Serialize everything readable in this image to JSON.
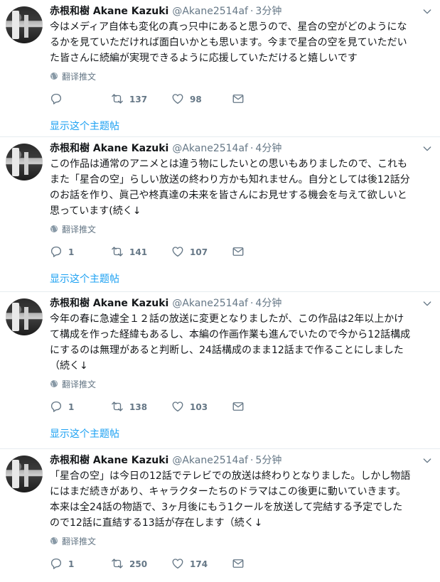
{
  "tweets": [
    {
      "name": "赤根和樹 Akane Kazuki",
      "handle": "@Akane2514af",
      "time": "3分钟",
      "lines": [
        "今はメディア自体も変化の真っ只中にあると思うので、星合の空がどのようにな",
        "るかを見ていただければ面白いかとも思います。今まで星合の空を見ていただい",
        "た皆さんに続編が実現できるように応援していただけると嬉しいです"
      ],
      "translate": "翻译推文",
      "reply_count": "",
      "retweet_count": "137",
      "like_count": "98",
      "thread_link": "显示这个主题帖"
    },
    {
      "name": "赤根和樹 Akane Kazuki",
      "handle": "@Akane2514af",
      "time": "4分钟",
      "lines": [
        "この作品は通常のアニメとは違う物にしたいとの思いもありましたので、これも",
        "また「星合の空」らしい放送の終わり方かも知れません。自分としては後12話分",
        "のお話を作り、眞己や柊真達の未来を皆さんにお見せする機会を与えて欲しいと",
        "思っています(続く↓"
      ],
      "translate": "翻译推文",
      "reply_count": "1",
      "retweet_count": "141",
      "like_count": "107",
      "thread_link": "显示这个主题帖"
    },
    {
      "name": "赤根和樹 Akane Kazuki",
      "handle": "@Akane2514af",
      "time": "4分钟",
      "lines": [
        "今年の春に急遽全１２話の放送に変更となりましたが、この作品は2年以上かけ",
        "て構成を作った経緯もあるし、本編の作画作業も進んでいたので今から12話構成",
        "にするのは無理があると判断し、24話構成のまま12話まで作ることにしました",
        "（続く↓"
      ],
      "translate": "翻译推文",
      "reply_count": "1",
      "retweet_count": "138",
      "like_count": "103",
      "thread_link": "显示这个主题帖"
    },
    {
      "name": "赤根和樹 Akane Kazuki",
      "handle": "@Akane2514af",
      "time": "5分钟",
      "lines": [
        "「星合の空」は今日の12話でテレビでの放送は終わりとなりました。しかし物語",
        "にはまだ続きがあり、キャラクターたちのドラマはこの後更に動いていきます。",
        "本来は全24話の物語で、3ヶ月後にもう1クールを放送して完結する予定でした",
        "ので12話に直結する13話が存在します（続く↓"
      ],
      "translate": "翻译推文",
      "reply_count": "1",
      "retweet_count": "250",
      "like_count": "174",
      "thread_link": ""
    }
  ],
  "dot": "·",
  "icons": {
    "avatar": "avatar",
    "caret": "chevron-down-icon",
    "translate": "globe-icon",
    "reply": "reply-icon",
    "retweet": "retweet-icon",
    "like": "heart-icon",
    "dm": "envelope-icon"
  },
  "colors": {
    "link": "#1da1f2",
    "muted": "#657786",
    "divider": "#e6ecf0"
  }
}
